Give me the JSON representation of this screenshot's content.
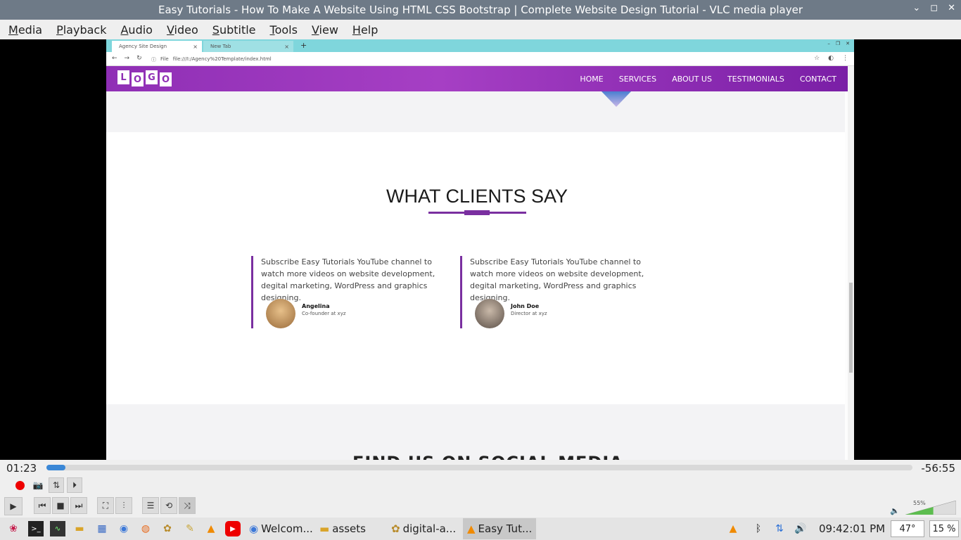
{
  "window": {
    "title": "Easy Tutorials - How To Make A Website Using HTML CSS Bootstrap | Complete Website Design Tutorial - VLC media player"
  },
  "menu": [
    "Media",
    "Playback",
    "Audio",
    "Video",
    "Subtitle",
    "Tools",
    "View",
    "Help"
  ],
  "browser": {
    "tabs": [
      {
        "label": "Agency Site Design",
        "close": "×"
      },
      {
        "label": "New Tab",
        "close": "×"
      }
    ],
    "new_tab": "+",
    "url_scheme": "File",
    "url": "file:///I:/Agency%20Template/index.html"
  },
  "site": {
    "logo_letters": [
      "L",
      "O",
      "G",
      "O"
    ],
    "nav": [
      "HOME",
      "SERVICES",
      "ABOUT US",
      "TESTIMONIALS",
      "CONTACT"
    ],
    "section_title": "WHAT CLIENTS SAY",
    "testimonials": [
      {
        "text": "Subscribe Easy Tutorials YouTube channel to watch more videos on website development, degital marketing, WordPress and graphics designing.",
        "name": "Angelina",
        "role": "Co-founder at xyz"
      },
      {
        "text": "Subscribe Easy Tutorials YouTube channel to watch more videos on website development, degital marketing, WordPress and graphics designing.",
        "name": "John Doe",
        "role": "Director at xyz"
      }
    ],
    "next_heading": "FIND US ON SOCIAL MEDIA"
  },
  "player": {
    "elapsed": "01:23",
    "remaining": "-56:55",
    "progress_fraction": 0.022,
    "volume_percent": "55%",
    "volume_fraction": 0.55
  },
  "taskbar": {
    "tasks": [
      "Welcom...",
      "assets",
      "digital-a...",
      "Easy Tut..."
    ],
    "clock": "09:42:01 PM",
    "temp": "47°",
    "cpu": "15 %"
  }
}
